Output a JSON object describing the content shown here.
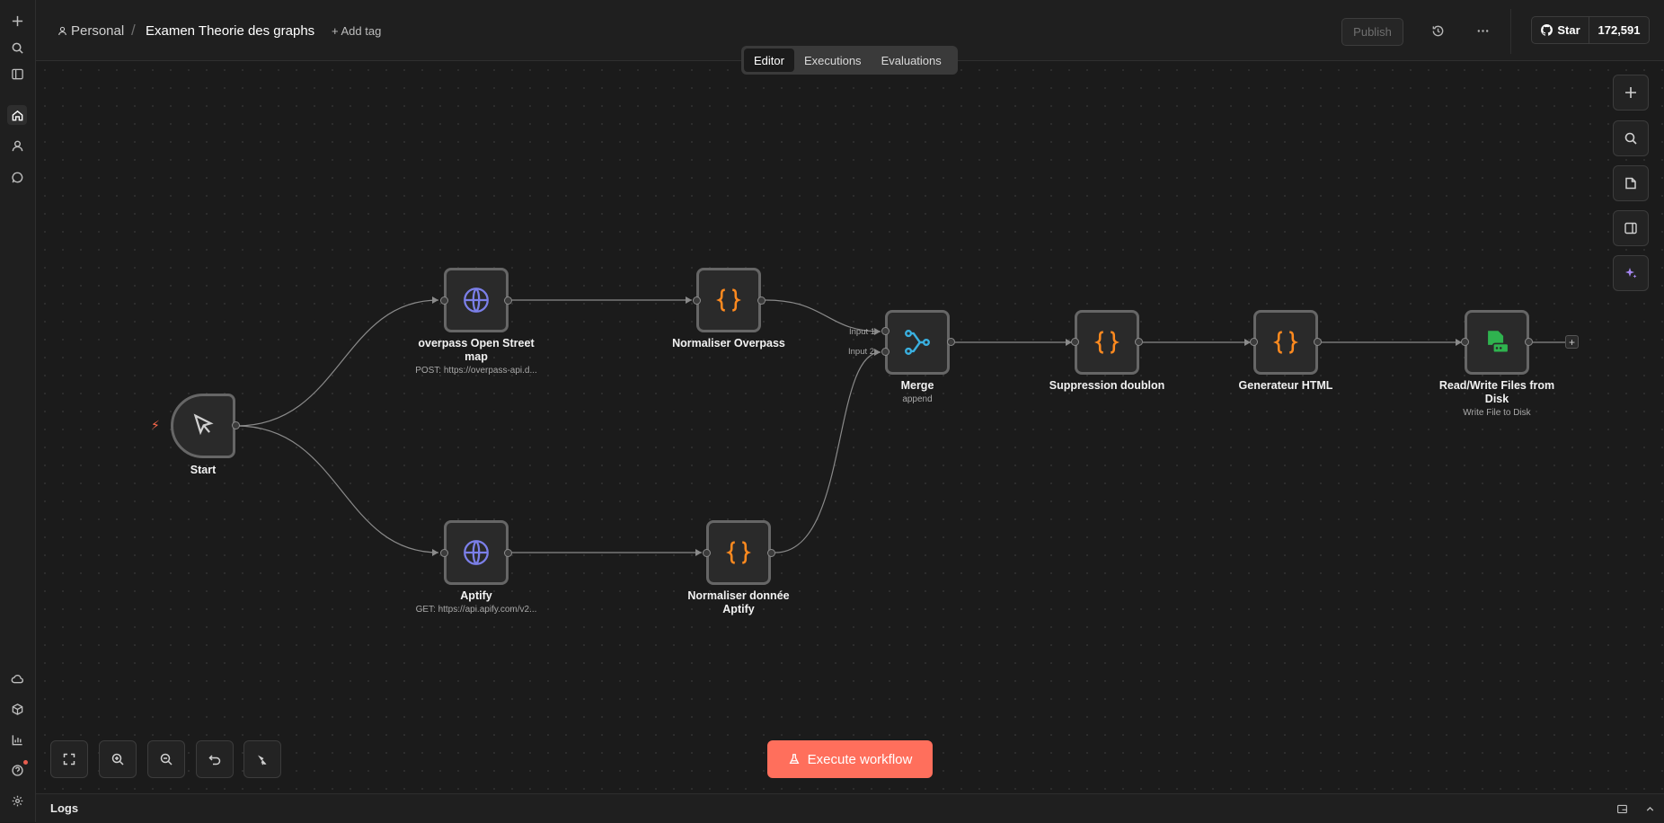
{
  "breadcrumb": {
    "project": "Personal",
    "separator": "/",
    "workflow_name": "Examen Theorie des graphs"
  },
  "header": {
    "add_tag": "+ Add tag",
    "publish": "Publish",
    "github_star": "Star",
    "github_count": "172,591"
  },
  "tabs": [
    {
      "label": "Editor",
      "active": true
    },
    {
      "label": "Executions"
    },
    {
      "label": "Evaluations"
    }
  ],
  "nodes": {
    "start": {
      "label": "Start",
      "icon": "cursor-icon"
    },
    "overpass": {
      "label": "overpass Open Street map",
      "sub": "POST: https://overpass-api.d...",
      "icon": "globe-icon"
    },
    "aptify": {
      "label": "Aptify",
      "sub": "GET: https://api.apify.com/v2...",
      "icon": "globe-icon"
    },
    "norm_overpass": {
      "label": "Normaliser Overpass",
      "icon": "code-braces-icon"
    },
    "norm_aptify": {
      "label": "Normaliser donnée Aptify",
      "icon": "code-braces-icon"
    },
    "merge": {
      "label": "Merge",
      "sub": "append",
      "input1": "Input 1",
      "input2": "Input 2",
      "icon": "merge-icon"
    },
    "dedupe": {
      "label": "Suppression doublon",
      "icon": "code-braces-icon"
    },
    "html_gen": {
      "label": "Generateur HTML",
      "icon": "code-braces-icon"
    },
    "rw_files": {
      "label": "Read/Write Files from Disk",
      "sub": "Write File to Disk",
      "icon": "file-disk-icon"
    }
  },
  "execute_button": "Execute workflow",
  "logs": {
    "label": "Logs"
  },
  "colors": {
    "accent": "#ff6f5c",
    "code_icon": "#ff8a1f",
    "globe_icon": "#7b7fe8",
    "merge_icon": "#3ab0e0",
    "file_icon": "#2fb34f",
    "trigger_bolt": "#ff6a4d"
  }
}
